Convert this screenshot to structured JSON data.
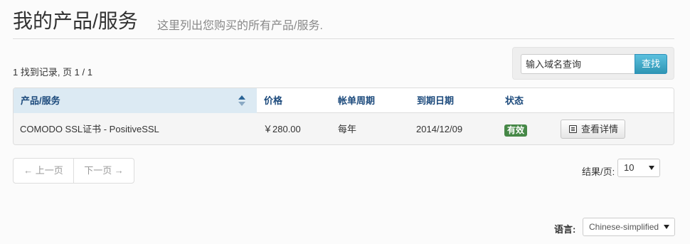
{
  "header": {
    "title": "我的产品/服务",
    "subtitle": "这里列出您购买的所有产品/服务."
  },
  "summary": {
    "records_text": "1 找到记录, 页 1 / 1"
  },
  "search": {
    "placeholder": "输入域名查询",
    "button_label": "查找"
  },
  "table": {
    "columns": [
      "产品/服务",
      "价格",
      "帐单周期",
      "到期日期",
      "状态"
    ],
    "sorted_column": "产品/服务",
    "rows": [
      {
        "product": "COMODO SSL证书 - PositiveSSL",
        "price": "￥280.00",
        "billing_cycle": "每年",
        "due_date": "2014/12/09",
        "status": "有效",
        "action_label": "查看详情",
        "action_icon": "list-icon"
      }
    ]
  },
  "pagination": {
    "prev_label": "← 上一页",
    "next_label": "下一页 →"
  },
  "per_page": {
    "label": "结果/页:",
    "value": "10"
  },
  "language": {
    "label": "语言:",
    "value": "Chinese-simplified"
  },
  "colors": {
    "accent": "#2f96b4",
    "status_active": "#468847",
    "header_sorted_bg": "#dceaf3",
    "header_text": "#1c4a7c"
  }
}
